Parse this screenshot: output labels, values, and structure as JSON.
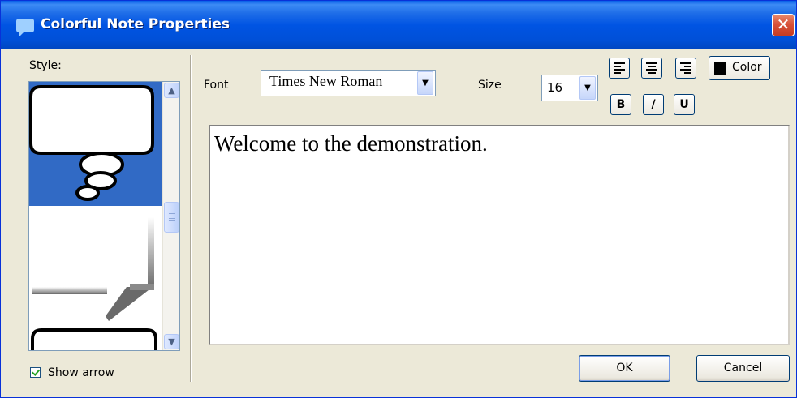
{
  "window": {
    "title": "Colorful Note Properties",
    "close_glyph": "✕",
    "icon": "note-balloon-icon"
  },
  "style_panel": {
    "label": "Style:",
    "items": [
      {
        "name": "thought-bubble",
        "selected": true
      },
      {
        "name": "speech-callout",
        "selected": false
      },
      {
        "name": "rounded-box",
        "selected": false
      }
    ],
    "scroll_up_glyph": "▲",
    "scroll_down_glyph": "▼",
    "show_arrow": {
      "label": "Show arrow",
      "checked": true
    }
  },
  "toolbar": {
    "font_label": "Font",
    "font_value": "Times New Roman",
    "size_label": "Size",
    "size_value": "16",
    "dropdown_glyph": "▼",
    "align_left_icon": "align-left-icon",
    "align_center_icon": "align-center-icon",
    "align_right_icon": "align-right-icon",
    "color_label": "Color",
    "color_value": "#000000",
    "bold_label": "B",
    "italic_label": "/",
    "underline_label": "U"
  },
  "note_text": "Welcome to the demonstration.",
  "buttons": {
    "ok": "OK",
    "cancel": "Cancel"
  },
  "colors": {
    "titlebar": "#0054e3",
    "selection": "#316ac5",
    "dialog_bg": "#ece9d8"
  }
}
